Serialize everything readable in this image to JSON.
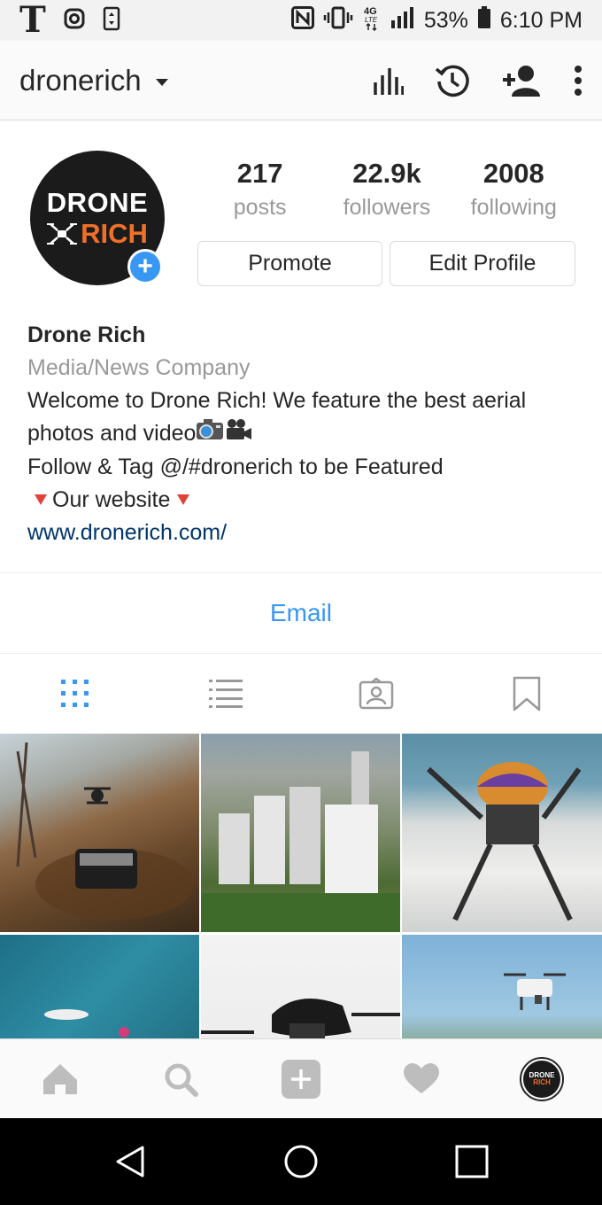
{
  "status_bar": {
    "carrier_logo": "T",
    "battery_percent": "53%",
    "time": "6:10 PM",
    "network": "4G LTE"
  },
  "header": {
    "username": "dronerich"
  },
  "profile": {
    "avatar_text_top": "DRONE",
    "avatar_text_bottom": "RICH",
    "stats": [
      {
        "value": "217",
        "label": "posts"
      },
      {
        "value": "22.9k",
        "label": "followers"
      },
      {
        "value": "2008",
        "label": "following"
      }
    ],
    "promote_label": "Promote",
    "edit_profile_label": "Edit Profile"
  },
  "bio": {
    "name": "Drone Rich",
    "category": "Media/News Company",
    "line1": "Welcome to Drone Rich! We feature the best aerial",
    "line2": "photos and video",
    "line3": "Follow & Tag @/#dronerich to be Featured",
    "line4": "Our website",
    "link": "www.dronerich.com/"
  },
  "contact": {
    "email_label": "Email"
  },
  "colors": {
    "accent_blue": "#3897f0",
    "link_dark_blue": "#003569",
    "avatar_orange": "#f0702a",
    "grey_text": "#999999"
  },
  "icons": {
    "header": [
      "insights-icon",
      "archive-history-icon",
      "discover-people-icon",
      "more-options-icon"
    ],
    "tabs": [
      "grid-view-icon",
      "list-view-icon",
      "tagged-photos-icon",
      "saved-icon"
    ],
    "bottom_nav": [
      "home-icon",
      "search-icon",
      "new-post-icon",
      "activity-heart-icon",
      "profile-avatar"
    ],
    "android_nav": [
      "back-icon",
      "home-circle-icon",
      "recents-icon"
    ]
  }
}
